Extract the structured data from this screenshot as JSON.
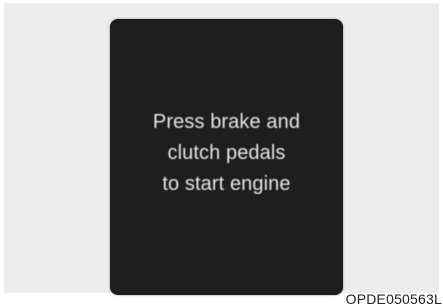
{
  "display": {
    "lines": [
      "Press brake and",
      "clutch pedals",
      "to start engine"
    ]
  },
  "figure_code": "OPDE050563L",
  "colors": {
    "background_panel": "#ececec",
    "screen": "#1e1e1e",
    "text": "#e6e6e6"
  }
}
